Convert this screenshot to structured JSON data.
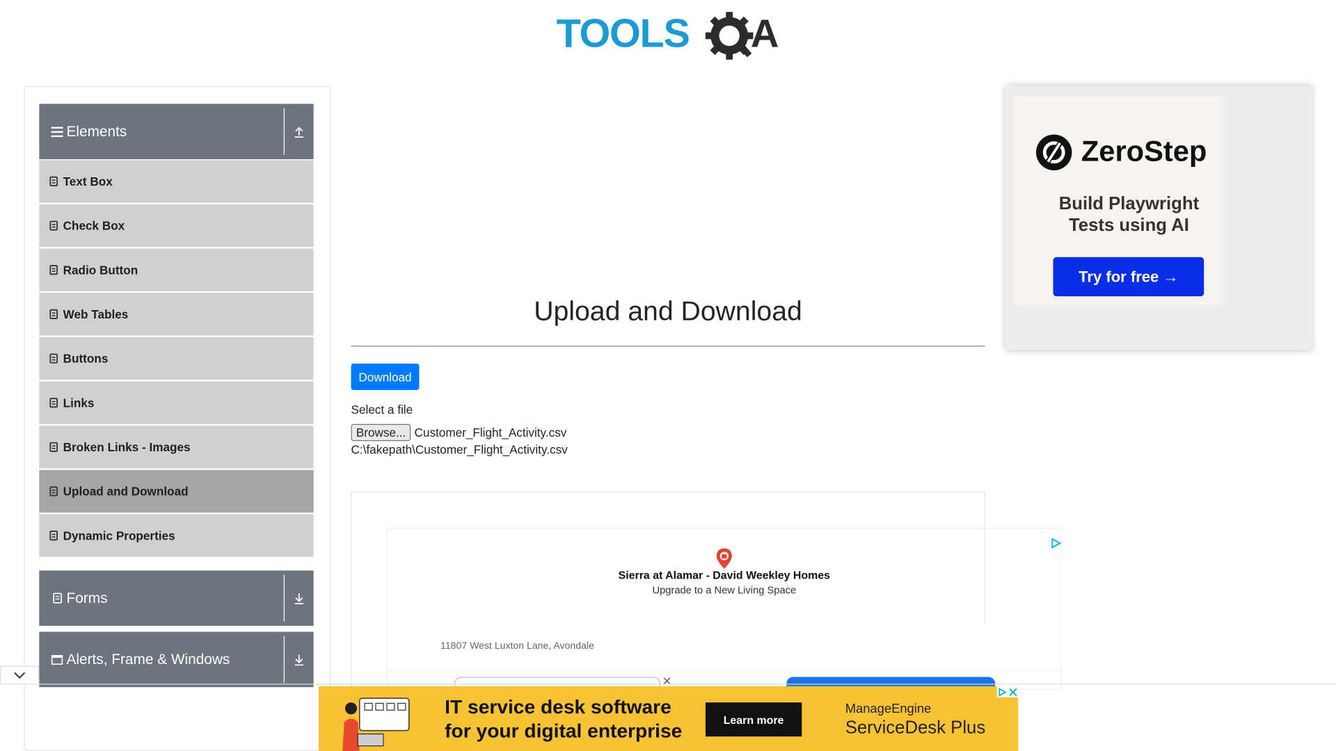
{
  "header": {
    "logo_text": "TOOLSQA"
  },
  "sidebar": {
    "groups": [
      {
        "label": "Elements",
        "icon": "menu-icon",
        "toggle_icon": "upload-arrow-icon"
      },
      {
        "label": "Forms",
        "icon": "form-icon",
        "toggle_icon": "download-arrow-icon"
      },
      {
        "label": "Alerts, Frame & Windows",
        "icon": "window-icon",
        "toggle_icon": "download-arrow-icon"
      }
    ],
    "items": [
      {
        "label": "Text Box"
      },
      {
        "label": "Check Box"
      },
      {
        "label": "Radio Button"
      },
      {
        "label": "Web Tables"
      },
      {
        "label": "Buttons"
      },
      {
        "label": "Links"
      },
      {
        "label": "Broken Links - Images"
      },
      {
        "label": "Upload and Download",
        "active": true
      },
      {
        "label": "Dynamic Properties"
      }
    ]
  },
  "main": {
    "title": "Upload and Download",
    "download_button": "Download",
    "select_label": "Select a file",
    "browse_button": "Browse...",
    "file_name": "Customer_Flight_Activity.csv",
    "uploaded_path": "C:\\fakepath\\Customer_Flight_Activity.csv"
  },
  "map_ad": {
    "headline": "Sierra at Alamar - David Weekley Homes",
    "subline": "Upgrade to a New Living Space",
    "address": "11807 West Luxton Lane, Avondale"
  },
  "right_ad": {
    "brand": "ZeroStep",
    "tagline": "Build Playwright Tests using AI",
    "button": "Try for free →"
  },
  "bottom_ad": {
    "line1": "IT service desk software",
    "line2": "for your digital enterprise",
    "button": "Learn more",
    "brand_line1": "ManageEngine",
    "brand_line2": "ServiceDesk Plus"
  },
  "colors": {
    "logo_blue": "#1c9ad6",
    "logo_dark": "#2c2c2c",
    "sidebar_header": "#6c757d",
    "sidebar_item": "#d0d0d0",
    "sidebar_item_active": "#a6a6a6",
    "primary": "#007bff",
    "zerostep_button": "#0a2ee8",
    "banner_yellow": "#f7c233"
  }
}
